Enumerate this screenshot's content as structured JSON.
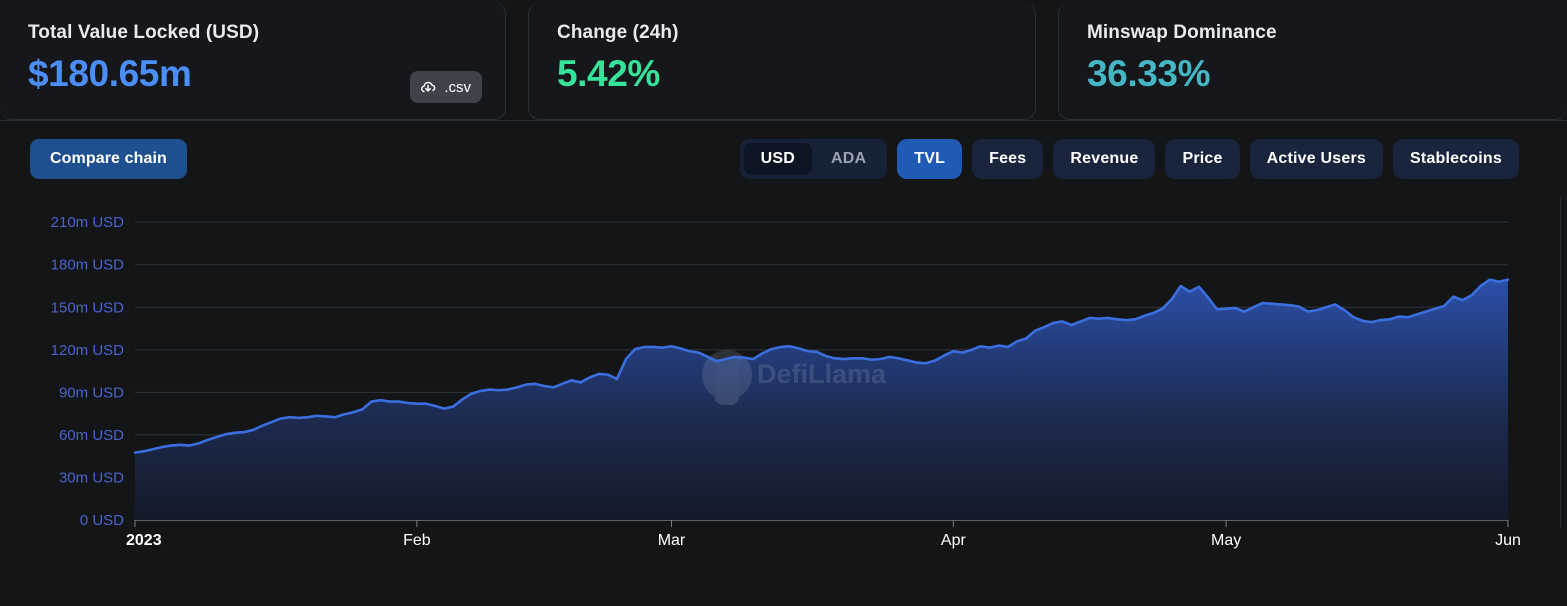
{
  "stats": [
    {
      "label": "Total Value Locked (USD)",
      "value": "$180.65m",
      "color": "#4b8ef7",
      "download_label": ".csv",
      "download_icon": "cloud-download-icon"
    },
    {
      "label": "Change (24h)",
      "value": "5.42%",
      "color": "#36e39a"
    },
    {
      "label": "Minswap Dominance",
      "value": "36.33%",
      "color": "#45b6c4"
    }
  ],
  "controls": {
    "compare_label": "Compare chain",
    "currency_toggle": {
      "options": [
        "USD",
        "ADA"
      ],
      "selected": "USD"
    },
    "metrics": [
      {
        "label": "TVL",
        "active": true
      },
      {
        "label": "Fees",
        "active": false
      },
      {
        "label": "Revenue",
        "active": false
      },
      {
        "label": "Price",
        "active": false
      },
      {
        "label": "Active Users",
        "active": false
      },
      {
        "label": "Stablecoins",
        "active": false
      }
    ]
  },
  "watermark": "DefiLlama",
  "chart_data": {
    "type": "area",
    "title": "",
    "xlabel": "",
    "ylabel": "",
    "ylim": [
      0,
      220
    ],
    "yticks": [
      0,
      30,
      60,
      90,
      120,
      150,
      180,
      210
    ],
    "ytick_labels": [
      "0 USD",
      "30m USD",
      "60m USD",
      "90m USD",
      "120m USD",
      "150m USD",
      "180m USD",
      "210m USD"
    ],
    "xticks": [
      0,
      31,
      59,
      90,
      120,
      151
    ],
    "xtick_labels": [
      "2023",
      "Feb",
      "Mar",
      "Apr",
      "May",
      "Jun"
    ],
    "grid": true,
    "legend": null,
    "line_color": "#3b6fe0",
    "fill_gradient": [
      "#2b4fa8",
      "#131b2c"
    ],
    "series": [
      {
        "name": "Total Value Locked (USD)",
        "unit": "m USD",
        "x": [
          0,
          1,
          2,
          3,
          4,
          5,
          6,
          7,
          8,
          9,
          10,
          11,
          12,
          13,
          14,
          15,
          16,
          17,
          18,
          19,
          20,
          21,
          22,
          23,
          24,
          25,
          26,
          27,
          28,
          29,
          30,
          31,
          32,
          33,
          34,
          35,
          36,
          37,
          38,
          39,
          40,
          41,
          42,
          43,
          44,
          45,
          46,
          47,
          48,
          49,
          50,
          51,
          52,
          53,
          54,
          55,
          56,
          57,
          58,
          59,
          60,
          61,
          62,
          63,
          64,
          65,
          66,
          67,
          68,
          69,
          70,
          71,
          72,
          73,
          74,
          75,
          76,
          77,
          78,
          79,
          80,
          81,
          82,
          83,
          84,
          85,
          86,
          87,
          88,
          89,
          90,
          91,
          92,
          93,
          94,
          95,
          96,
          97,
          98,
          99,
          100,
          101,
          102,
          103,
          104,
          105,
          106,
          107,
          108,
          109,
          110,
          111,
          112,
          113,
          114,
          115,
          116,
          117,
          118,
          119,
          120,
          121,
          122,
          123,
          124,
          125,
          126,
          127,
          128,
          129,
          130,
          131,
          132,
          133,
          134,
          135,
          136,
          137,
          138,
          139,
          140,
          141,
          142,
          143,
          144,
          145,
          146,
          147,
          148,
          149,
          150,
          151
        ],
        "values": [
          47.5,
          48.5,
          50.0,
          51.5,
          52.5,
          53.0,
          52.5,
          54.0,
          56.5,
          58.5,
          60.5,
          61.5,
          62.0,
          63.5,
          66.5,
          69.0,
          71.5,
          72.5,
          72.0,
          72.5,
          73.5,
          73.0,
          72.5,
          74.5,
          76.0,
          78.0,
          83.5,
          84.5,
          83.5,
          83.5,
          82.5,
          82.0,
          82.0,
          80.5,
          78.5,
          80.0,
          85.0,
          89.0,
          91.0,
          92.0,
          91.5,
          92.0,
          93.5,
          95.5,
          96.0,
          94.5,
          93.5,
          96.0,
          98.5,
          97.0,
          100.5,
          103.0,
          102.5,
          99.5,
          113.5,
          120.5,
          122.0,
          122.0,
          121.5,
          122.5,
          121.0,
          119.0,
          118.0,
          115.0,
          112.0,
          113.5,
          115.0,
          114.5,
          113.5,
          117.5,
          120.5,
          122.0,
          122.5,
          121.0,
          119.0,
          118.5,
          115.5,
          114.0,
          113.5,
          114.0,
          114.0,
          113.0,
          113.5,
          115.0,
          114.0,
          112.5,
          111.0,
          110.5,
          112.5,
          116.0,
          119.0,
          118.0,
          120.0,
          122.5,
          121.5,
          123.0,
          122.0,
          126.0,
          128.0,
          133.5,
          136.0,
          139.0,
          140.0,
          137.5,
          140.0,
          142.5,
          142.0,
          142.5,
          141.5,
          141.0,
          141.5,
          144.0,
          146.0,
          149.0,
          155.5,
          165.0,
          161.0,
          164.5,
          157.0,
          148.5,
          149.0,
          149.5,
          147.0,
          150.0,
          153.0,
          152.5,
          152.0,
          151.5,
          150.5,
          147.0,
          148.0,
          150.0,
          152.0,
          148.0,
          143.0,
          140.5,
          139.5,
          141.0,
          141.5,
          143.5,
          143.0,
          145.0,
          147.0,
          149.0,
          151.0,
          157.5,
          155.0,
          158.5,
          165.0,
          169.5,
          168.0,
          169.5,
          170.0,
          165.0,
          180.5
        ]
      }
    ]
  }
}
